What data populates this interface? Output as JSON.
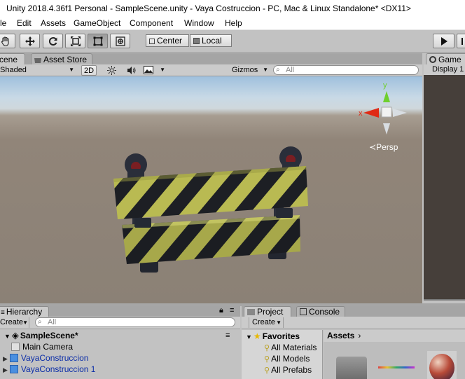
{
  "window": {
    "title": "Unity 2018.4.36f1 Personal - SampleScene.unity - Vaya Costruccion - PC, Mac & Linux Standalone* <DX11>"
  },
  "menu": [
    "le",
    "Edit",
    "Assets",
    "GameObject",
    "Component",
    "Window",
    "Help"
  ],
  "toolbar": {
    "tools": [
      "hand-tool",
      "move-tool",
      "rotate-tool",
      "scale-tool",
      "rect-tool",
      "transform-tool"
    ],
    "pivot_mode": "Center",
    "pivot_rotation": "Local"
  },
  "scene_view": {
    "tabs": [
      "cene",
      "Asset Store"
    ],
    "draw_mode": "Shaded",
    "mode_2d": "2D",
    "gizmos": "Gizmos",
    "search_placeholder": "All",
    "gizmo_axes": {
      "y": "y",
      "x": "x"
    },
    "projection": "Persp"
  },
  "game_view": {
    "tab": "Game",
    "display": "Display 1"
  },
  "hierarchy": {
    "tab": "Hierarchy",
    "create": "Create",
    "search_placeholder": "All",
    "scene_name": "SampleScene*",
    "items": [
      {
        "label": "Main Camera",
        "prefab": false,
        "expandable": false
      },
      {
        "label": "VayaConstruccion",
        "prefab": true,
        "expandable": true
      },
      {
        "label": "VayaConstruccion 1",
        "prefab": true,
        "expandable": true
      }
    ]
  },
  "project": {
    "tabs": [
      "Project",
      "Console"
    ],
    "create": "Create",
    "favorites_label": "Favorites",
    "favorites": [
      "All Materials",
      "All Models",
      "All Prefabs"
    ],
    "assets_label": "Assets"
  },
  "colors": {
    "window_bg": "#c2c2c2",
    "prefab_blue": "#0c2ea8",
    "stripe_yellow": "#b9ba52",
    "stripe_dark": "#1d1f24",
    "game_view_bg": "#463f3a",
    "axis_y": "#6fcf2e",
    "axis_x": "#e02a14"
  }
}
